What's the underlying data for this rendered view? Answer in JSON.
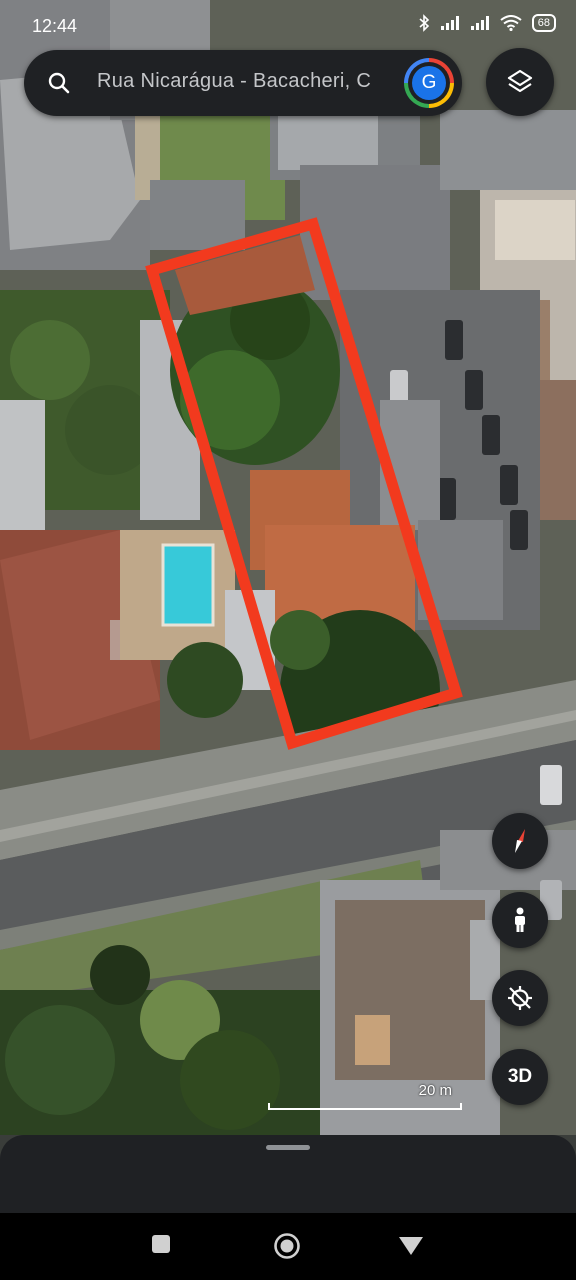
{
  "status_bar": {
    "time": "12:44",
    "battery": "68",
    "icons": [
      "bluetooth-icon",
      "signal-icon",
      "signal-icon",
      "wifi-icon",
      "battery-icon"
    ]
  },
  "search": {
    "text": "Rua Nicarágua - Bacacheri, C",
    "avatar_letter": "G"
  },
  "map": {
    "type": "satellite",
    "highlight_color": "#f23a1e",
    "scale_label": "20 m"
  },
  "controls": {
    "compass": "compass-icon",
    "street_view": "pegman-icon",
    "location": "location-off-icon",
    "three_d_label": "3D",
    "layers": "layers-icon"
  },
  "nav": [
    "recents-button",
    "home-button",
    "back-button"
  ]
}
